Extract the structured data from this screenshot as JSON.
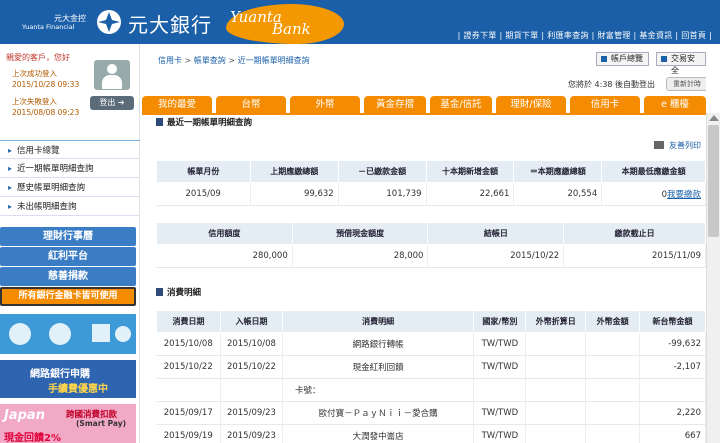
{
  "header": {
    "logo_zh_small": "元大金控",
    "logo_en_small": "Yuanta Financial",
    "bank_name": "元大銀行",
    "brand_en_1": "Yuanta",
    "brand_en_2": "Bank",
    "links": [
      "證券下單",
      "期貨下單",
      "利匯率查詢",
      "財富管理",
      "基金資訊",
      "回首頁"
    ]
  },
  "sidebar": {
    "welcome": "親愛的客戶，您好",
    "last_success_label": "上次成功登入",
    "last_success_time": "2015/10/28 09:33",
    "last_fail_label": "上次失敗登入",
    "last_fail_time": "2015/08/08 09:23",
    "logout_label": "登出",
    "nav": [
      "信用卡總覽",
      "近一期帳單明細查詢",
      "歷史帳單明細查詢",
      "未出帳明細查詢"
    ],
    "buttons": [
      "理財行事曆",
      "紅利平台",
      "慈善捐款"
    ],
    "all_bank_card": "所有銀行金融卡皆可使用",
    "promo1": "網路銀行申購",
    "promo1b": "手續費優惠中",
    "promo2_brand": "Japan",
    "promo2a": "跨國消費扣款",
    "promo2b": "(Smart Pay)",
    "promo2c": "現金回饋2%"
  },
  "main": {
    "breadcrumb": [
      "信用卡",
      "帳單查詢",
      "近一期帳單明細查詢"
    ],
    "overview_btn": "帳戶總覽",
    "security_btn": "交易安全",
    "login_time": "您將於 4:38 後自動登出",
    "relogin": "重新計時",
    "tabs": [
      "我的最愛",
      "台幣",
      "外幣",
      "黃金存摺",
      "基金/信託",
      "理財/保險",
      "信用卡",
      "e 櫃檯"
    ],
    "section1": "最近一期帳單明細查詢",
    "print": "友善列印",
    "section2": "消費明細"
  },
  "summary": {
    "headers": [
      "帳單月份",
      "上期應繳總額",
      "－已繳款金額",
      "十本期新增金額",
      "＝本期應繳總額",
      "本期最低應繳金額"
    ],
    "row": {
      "month": "2015/09",
      "prev_due": "99,632",
      "paid": "101,739",
      "new_amt": "22,661",
      "total_due": "20,554",
      "min_due_amt": "0",
      "min_due_link": "我要繳款"
    }
  },
  "limits": {
    "headers": [
      "信用額度",
      "預借現金額度",
      "結帳日",
      "繳款截止日"
    ],
    "row": [
      "280,000",
      "28,000",
      "2015/10/22",
      "2015/11/09"
    ]
  },
  "transactions": {
    "headers": [
      "消費日期",
      "入帳日期",
      "消費明細",
      "國家/幣別",
      "外幣折算日",
      "外幣金額",
      "新台幣金額"
    ],
    "rows": [
      {
        "date": "2015/10/08",
        "post": "2015/10/08",
        "desc": "網路銀行轉帳",
        "cur": "TW/TWD",
        "fxdate": "",
        "fxamt": "",
        "twd": "-99,632"
      },
      {
        "date": "2015/10/22",
        "post": "2015/10/22",
        "desc": "現金紅利回饋",
        "cur": "TW/TWD",
        "fxdate": "",
        "fxamt": "",
        "twd": "-2,107"
      },
      {
        "date": "",
        "post": "",
        "desc": "卡號：",
        "cur": "",
        "fxdate": "",
        "fxamt": "",
        "twd": ""
      },
      {
        "date": "2015/09/17",
        "post": "2015/09/23",
        "desc": "歐付寶－ＰａｙＮｉｉ－愛合購",
        "cur": "TW/TWD",
        "fxdate": "",
        "fxamt": "",
        "twd": "2,220"
      },
      {
        "date": "2015/09/19",
        "post": "2015/09/23",
        "desc": "大潤發中崙店",
        "cur": "TW/TWD",
        "fxdate": "",
        "fxamt": "",
        "twd": "667"
      }
    ]
  }
}
